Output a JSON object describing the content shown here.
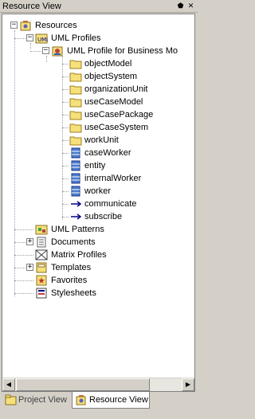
{
  "window": {
    "title": "Resource View",
    "pin_glyph": "⬟",
    "close_glyph": "✕"
  },
  "tree": {
    "resources": "Resources",
    "uml_profiles": "UML Profiles",
    "uml_profile_business": "UML Profile for Business Mo",
    "items": [
      {
        "label": "objectModel",
        "icon": "folder-icon"
      },
      {
        "label": "objectSystem",
        "icon": "folder-icon"
      },
      {
        "label": "organizationUnit",
        "icon": "folder-icon"
      },
      {
        "label": "useCaseModel",
        "icon": "folder-icon"
      },
      {
        "label": "useCasePackage",
        "icon": "folder-icon"
      },
      {
        "label": "useCaseSystem",
        "icon": "folder-icon"
      },
      {
        "label": "workUnit",
        "icon": "folder-icon"
      },
      {
        "label": "caseWorker",
        "icon": "class-icon"
      },
      {
        "label": "entity",
        "icon": "class-icon"
      },
      {
        "label": "internalWorker",
        "icon": "class-icon"
      },
      {
        "label": "worker",
        "icon": "class-icon"
      },
      {
        "label": "communicate",
        "icon": "association-arrow-icon"
      },
      {
        "label": "subscribe",
        "icon": "association-arrow-icon"
      }
    ],
    "uml_patterns": "UML Patterns",
    "documents": "Documents",
    "matrix_profiles": "Matrix Profiles",
    "templates": "Templates",
    "favorites": "Favorites",
    "stylesheets": "Stylesheets"
  },
  "scrollbar": {
    "left_arrow": "◀",
    "right_arrow": "▶"
  },
  "tabs": {
    "project_view": "Project View",
    "resource_view": "Resource View",
    "active": "Resource View"
  },
  "colors": {
    "chrome": "#d4d0c8",
    "folder": "#f5e07a",
    "class_icon": "#4a7fd0",
    "arrow": "#000080"
  }
}
